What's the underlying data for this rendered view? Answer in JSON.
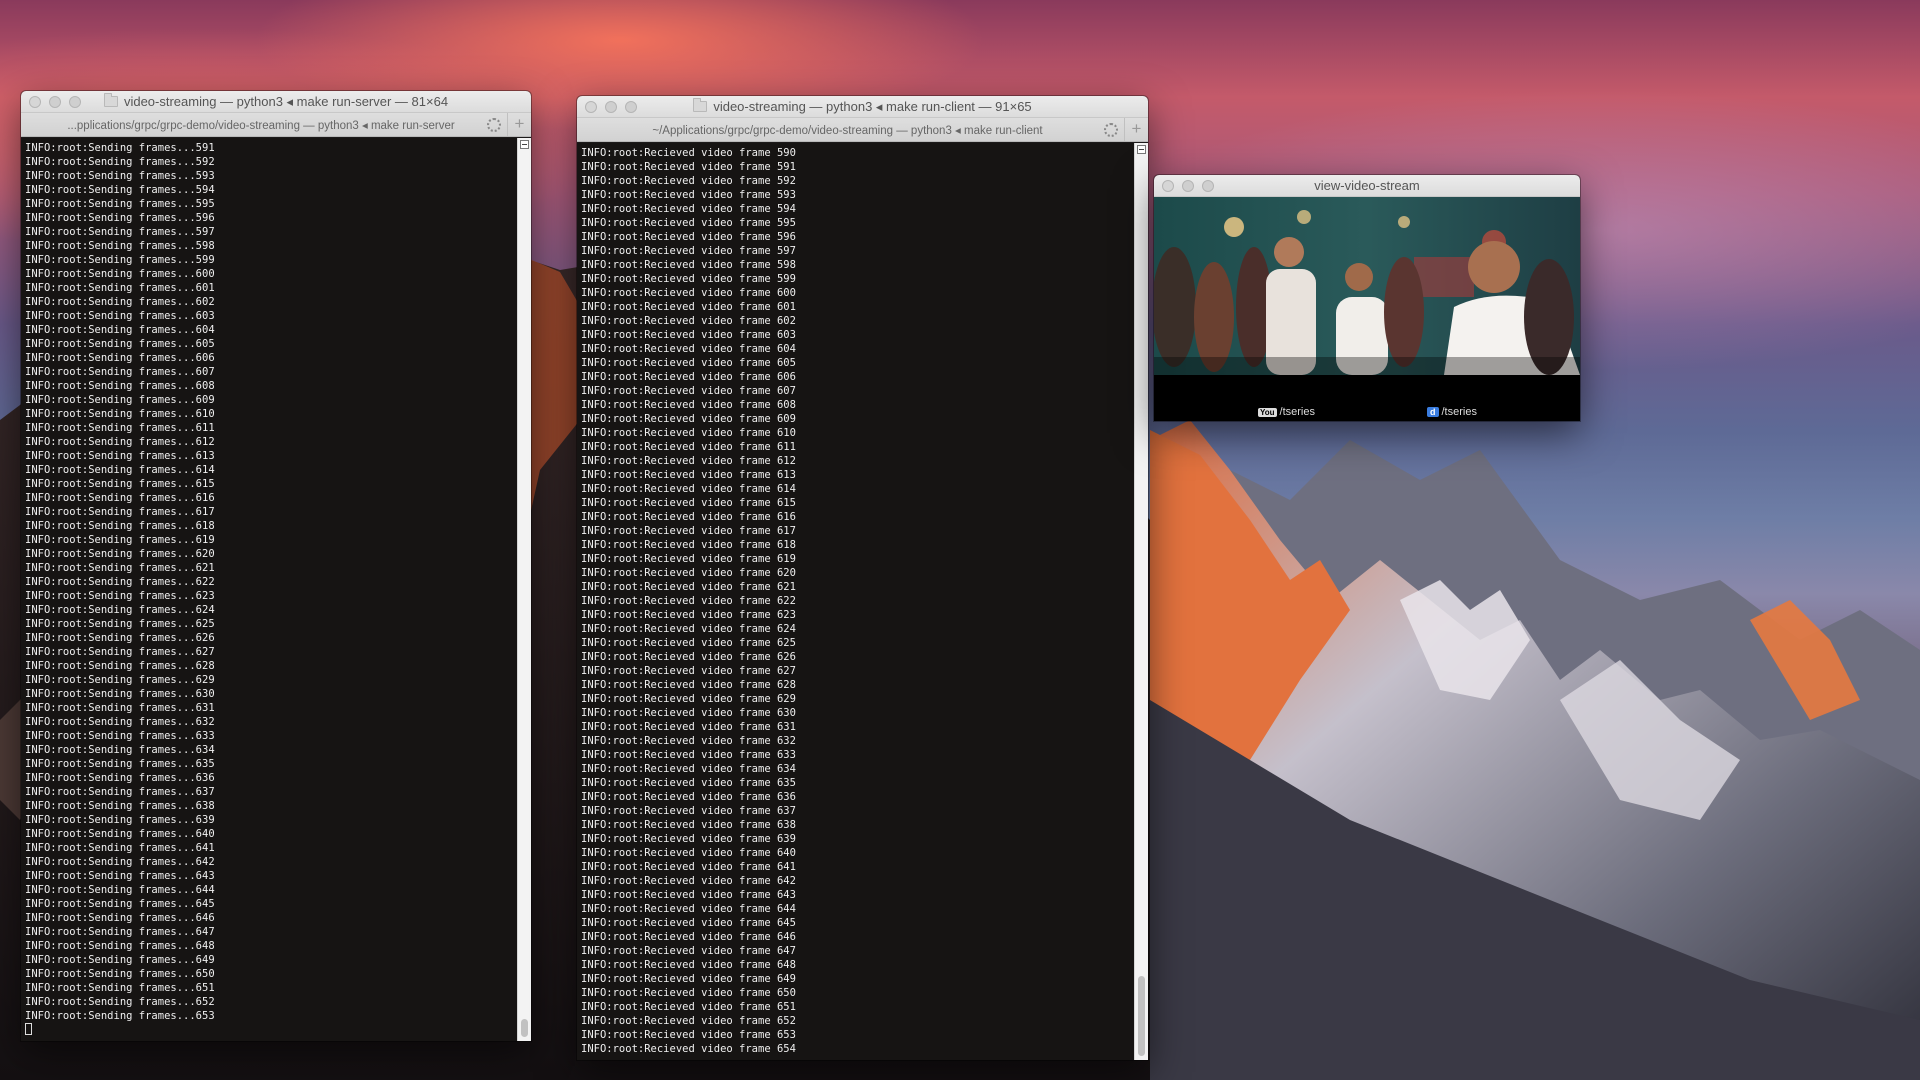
{
  "windows": {
    "server": {
      "title": "video-streaming — python3 ◂ make run-server — 81×64",
      "tab": "...pplications/grpc/grpc-demo/video-streaming — python3 ◂ make run-server",
      "log_prefix": "INFO:root:Sending frames...",
      "frame_start": 591,
      "frame_end": 653
    },
    "client": {
      "title": "video-streaming — python3 ◂ make run-client — 91×65",
      "tab": "~/Applications/grpc/grpc-demo/video-streaming — python3 ◂ make run-client",
      "log_prefix": "INFO:root:Recieved video frame ",
      "frame_start": 590,
      "frame_end": 654
    },
    "video": {
      "title": "view-video-stream",
      "watermark_left_badge": "You",
      "watermark_left": "/tseries",
      "watermark_right_badge": "d",
      "watermark_right": "/tseries"
    }
  },
  "colors": {
    "terminal_bg": "#161413",
    "terminal_text": "#f0f0f0",
    "titlebar": "#e4e4e4"
  },
  "icons": [
    "folder-icon",
    "spinner-icon",
    "plus-icon",
    "close-dot",
    "minimize-dot",
    "zoom-dot"
  ]
}
